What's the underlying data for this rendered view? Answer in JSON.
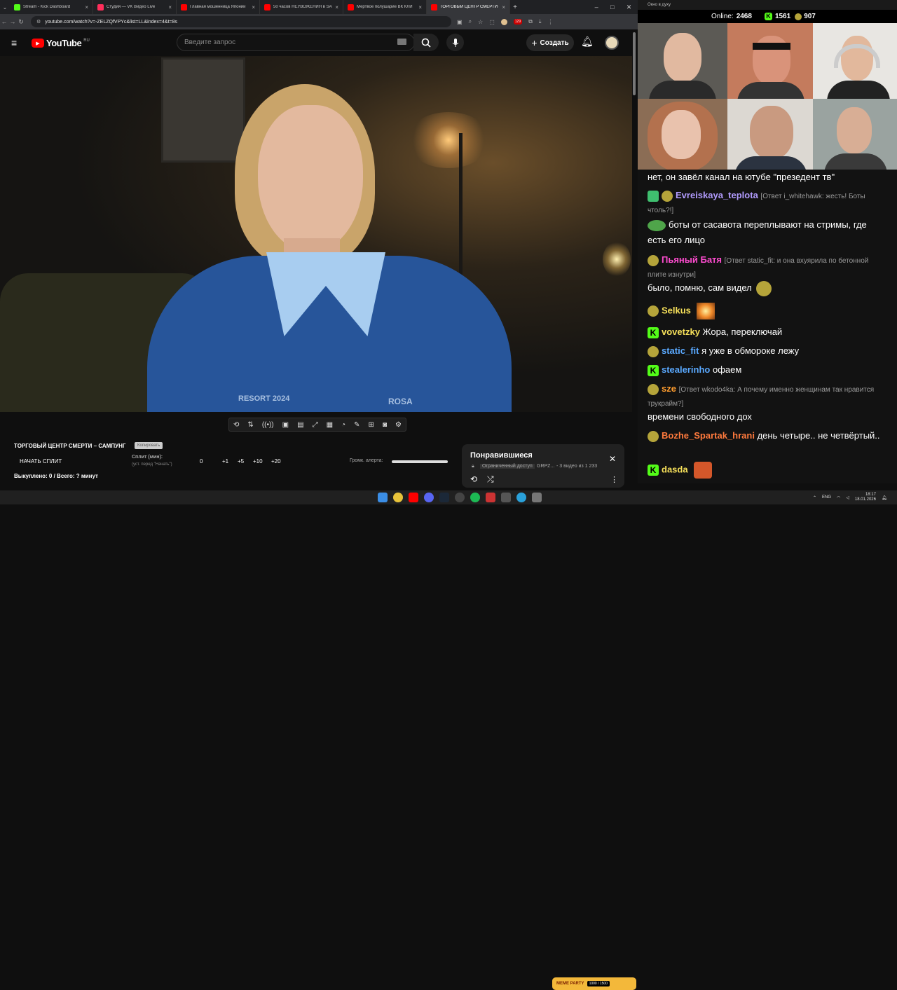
{
  "browser": {
    "tabs": [
      {
        "title": "Stream - Kick Dashboard",
        "color": "#53fc18"
      },
      {
        "title": "Студия — VK Видео Live",
        "color": "#ff2e5b"
      },
      {
        "title": "Главная мошенница Японии",
        "color": "#ff0000"
      },
      {
        "title": "50 часов НЕУВОЖЕНИЯ в SAI",
        "color": "#ff0000"
      },
      {
        "title": "Мертвое полушарие ВК КЛИ",
        "color": "#ff0000"
      },
      {
        "title": "ТОРГОВЫЙ ЦЕНТР СМЕРТИ - ",
        "color": "#ff0000",
        "active": true
      }
    ],
    "url": "youtube.com/watch?v=-ZELZQfVPYc&list=LL&index=4&t=8s",
    "ext_badge": "129"
  },
  "youtube": {
    "logo": "YouTube",
    "region": "RU",
    "search_placeholder": "Введите запрос",
    "create_label": "Создать"
  },
  "video": {
    "shirt_text_1": "RESORT 2024",
    "shirt_text_2": "ROSA"
  },
  "overlay": {
    "title": "ТОРГОВЫЙ ЦЕНТР СМЕРТИ – САМПУНГ",
    "copy_btn": "Копировать",
    "split_btn": "НАЧАТЬ СПЛИТ",
    "split_label": "Сплит (мин):",
    "split_hint": "(уст. перед \"Начать\")",
    "split_value": "0",
    "increments": [
      "+1",
      "+5",
      "+10",
      "+20"
    ],
    "alert_label": "Громк. алерта:",
    "redeemed": "Выкуплено: 0 / Всего: ? минут"
  },
  "liked": {
    "title": "Понравившиеся",
    "access": "Ограниченный доступ",
    "owner": "GRPZ...",
    "counter": "- 3 видео из 1 233"
  },
  "stream": {
    "window_title": "Окно в духу",
    "online_label": "Online:",
    "online_value": "2468",
    "kick_count": "1561",
    "other_count": "907"
  },
  "chat": [
    {
      "text": "нет, он завёл канал на ютубе \"презедент тв\""
    },
    {
      "user": "Evreiskaya_teplota",
      "color": "#b29cff",
      "reply": "[Ответ i_whitehawk: жесть! Боты чтоль?!]"
    },
    {
      "text": "боты от сасавота переплывают на стримы, где есть его лицо"
    },
    {
      "user": "Пьяный Батя",
      "color": "#ff4cd0",
      "reply": "[Ответ static_fit: и она вхуярила по бетонной плите изнутри]"
    },
    {
      "text": "было, помню, сам видел"
    },
    {
      "user": "Selkus",
      "color": "#f6e05a"
    },
    {
      "user": "vovetzky",
      "color": "#f6e05a",
      "text": "Жора, переключай"
    },
    {
      "user": "static_fit",
      "color": "#5aa9ff",
      "text": "я уже в обмороке лежу"
    },
    {
      "user": "stealerinho",
      "color": "#5aa9ff",
      "text": "офаем"
    },
    {
      "user": "sze",
      "color": "#ff9d2e",
      "reply": "[Ответ wkodo4ka: А почему именно женщинам так нравится трукрайм?]"
    },
    {
      "text": "времени свободного дох"
    },
    {
      "user": "Bozhe_Spartak_hrani",
      "color": "#ff7a3d",
      "text": "день четыре.. не четвёртый.."
    },
    {
      "user": "dasda",
      "color": "#f6e05a"
    }
  ],
  "taskbar": {
    "meme_label": "MEME PARTY",
    "meme_counter": "1000 / 1500",
    "lang": "ENG",
    "time": "18:17",
    "date": "18.01.2026"
  }
}
